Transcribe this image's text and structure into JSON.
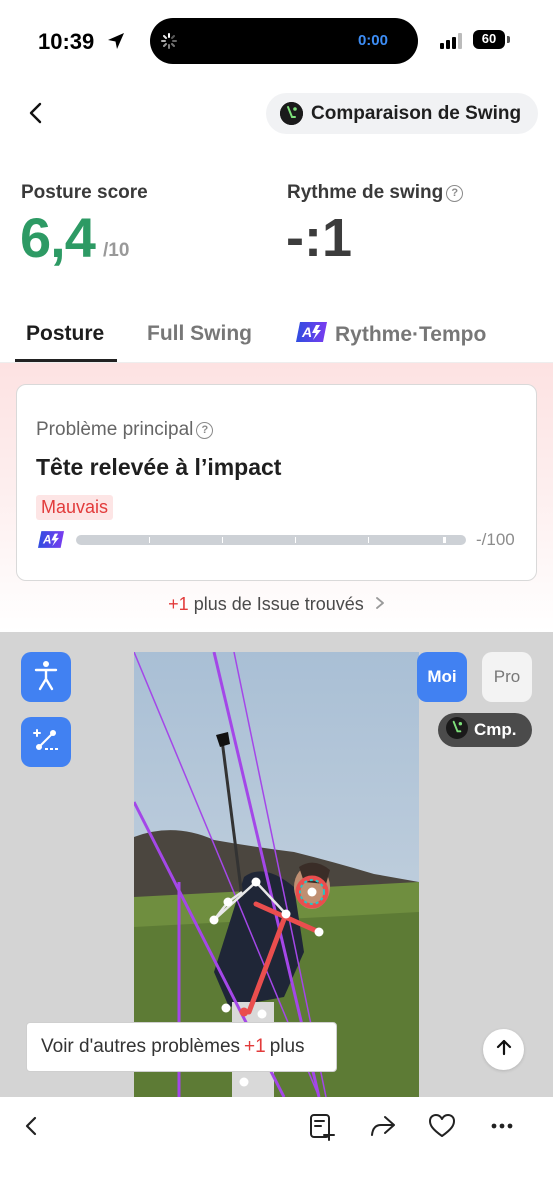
{
  "status_bar": {
    "time": "10:39",
    "timer": "0:00",
    "battery": "60"
  },
  "header": {
    "compare_label": "Comparaison de Swing"
  },
  "scores": {
    "posture_label": "Posture score",
    "posture_value": "6,4",
    "posture_max": "/10",
    "rythme_label": "Rythme de swing",
    "rythme_value": "-:1"
  },
  "tabs": [
    {
      "label": "Posture",
      "active": true
    },
    {
      "label": "Full Swing",
      "active": false
    },
    {
      "label": "Rythme·Tempo",
      "active": false
    }
  ],
  "issue": {
    "label": "Problème principal",
    "title": "Tête relevée à l’impact",
    "severity": "Mauvais",
    "score": "-/100",
    "more_count": "+1",
    "more_text": "plus de Issue trouvés"
  },
  "video": {
    "moi_label": "Moi",
    "pro_label": "Pro",
    "cmp_label": "Cmp.",
    "other_issues_text": "Voir d'autres problèmes",
    "other_issues_count": "+1",
    "other_issues_suffix": "plus"
  },
  "colors": {
    "accent": "#4181f2",
    "score_green": "#2d9a64",
    "bad_red": "#e23b3b"
  }
}
